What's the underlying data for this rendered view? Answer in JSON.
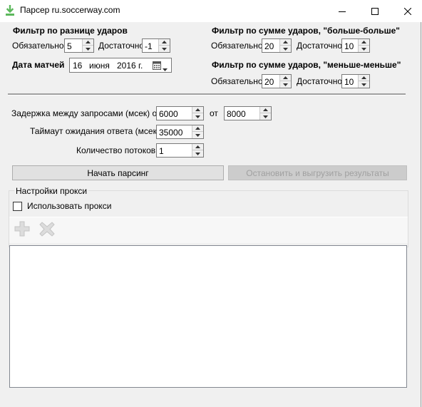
{
  "window": {
    "title": "Парсер ru.soccerway.com"
  },
  "shot_diff_filter": {
    "heading": "Фильтр по разнице ударов",
    "required_label": "Обязательно",
    "required_value": "5",
    "sufficient_label": "Достаточно",
    "sufficient_value": "-1"
  },
  "match_date": {
    "label": "Дата матчей",
    "day": "16",
    "month": "июня",
    "year": "2016 г."
  },
  "sum_more_filter": {
    "heading": "Фильтр по сумме ударов, \"больше-больше\"",
    "required_label": "Обязательно",
    "required_value": "20",
    "sufficient_label": "Достаточно",
    "sufficient_value": "10"
  },
  "sum_less_filter": {
    "heading": "Фильтр по сумме ударов, \"меньше-меньше\"",
    "required_label": "Обязательно",
    "required_value": "20",
    "sufficient_label": "Достаточно",
    "sufficient_value": "10"
  },
  "settings": {
    "delay_label": "Задержка между запросами (мсек) от",
    "delay_from": "6000",
    "delay_to_label": "от",
    "delay_to": "8000",
    "timeout_label": "Таймаут ожидания ответа (мсек)",
    "timeout_value": "35000",
    "threads_label": "Количество потоков",
    "threads_value": "1"
  },
  "actions": {
    "start_label": "Начать парсинг",
    "stop_label": "Остановить и выгрузить результаты"
  },
  "proxy": {
    "group_title": "Настройки прокси",
    "use_proxy_label": "Использовать прокси",
    "use_proxy_checked": false,
    "add_icon": "plus-icon",
    "remove_icon": "cross-icon"
  },
  "colors": {
    "window_bg": "#f0f0f0",
    "icon_green": "#5cb85c",
    "disabled_icon": "#c8c8c8"
  }
}
